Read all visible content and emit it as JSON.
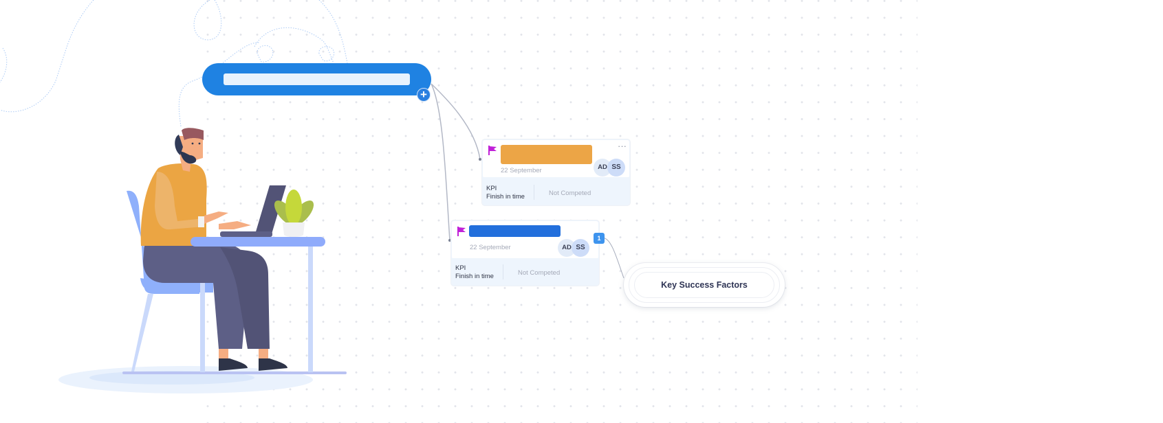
{
  "canvas": {
    "root_node": {
      "title_value": "",
      "add_button_label": "+",
      "color": "#1f82e2"
    },
    "cards": [
      {
        "flag_color": "#c020d8",
        "title_bar_color": "#eca546",
        "title_value": "",
        "date": "22 September",
        "assignees": [
          "AD",
          "SS"
        ],
        "more_label": "···",
        "kpi_label": "KPI",
        "kpi_value": "Finish in time",
        "status": "Not Competed"
      },
      {
        "flag_color": "#c020d8",
        "title_bar_color": "#226fdc",
        "title_value": "",
        "date": "22 September",
        "assignees": [
          "AD",
          "SS"
        ],
        "kpi_label": "KPI",
        "kpi_value": "Finish in time",
        "status": "Not Competed",
        "child_count": "1"
      }
    ],
    "ksf_node": {
      "label": "Key Success Factors"
    }
  },
  "illustration": {
    "subject": "man-typing-at-laptop-on-desk",
    "colors": {
      "sweater": "#eba543",
      "pants": "#5d5f86",
      "chair": "#8fb0fb",
      "desk": "#8fabfb",
      "plant": "#c5d83a"
    }
  }
}
